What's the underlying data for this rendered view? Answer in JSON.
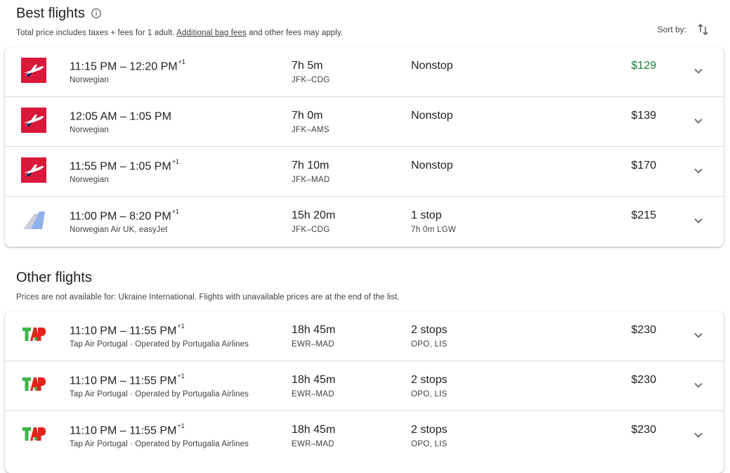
{
  "best": {
    "title": "Best flights",
    "subtitle_prefix": "Total price includes taxes + fees for 1 adult. ",
    "subtitle_link": "Additional bag fees",
    "subtitle_suffix": " and other fees may apply.",
    "sort_label": "Sort by:",
    "flights": [
      {
        "time": "11:15 PM – 12:20 PM",
        "plus": "+1",
        "airline": "Norwegian",
        "duration": "7h 5m",
        "route": "JFK–CDG",
        "stops": "Nonstop",
        "stop_detail": "",
        "price": "$129",
        "logo": "norwegian-logo",
        "price_low": true
      },
      {
        "time": "12:05 AM – 1:05 PM",
        "plus": "",
        "airline": "Norwegian",
        "duration": "7h 0m",
        "route": "JFK–AMS",
        "stops": "Nonstop",
        "stop_detail": "",
        "price": "$139",
        "logo": "norwegian-logo",
        "price_low": false
      },
      {
        "time": "11:55 PM – 1:05 PM",
        "plus": "+1",
        "airline": "Norwegian",
        "duration": "7h 10m",
        "route": "JFK–MAD",
        "stops": "Nonstop",
        "stop_detail": "",
        "price": "$170",
        "logo": "norwegian-logo",
        "price_low": false
      },
      {
        "time": "11:00 PM – 8:20 PM",
        "plus": "+1",
        "airline": "Norwegian Air UK, easyJet",
        "duration": "15h 20m",
        "route": "JFK–CDG",
        "stops": "1 stop",
        "stop_detail": "7h 0m LGW",
        "price": "$215",
        "logo": "multi-airline-tail-logo",
        "price_low": false
      }
    ]
  },
  "other": {
    "title": "Other flights",
    "subtitle": "Prices are not available for: Ukraine International. Flights with unavailable prices are at the end of the list.",
    "flights": [
      {
        "time": "11:10 PM – 11:55 PM",
        "plus": "+1",
        "airline": "Tap Air Portugal · Operated by Portugalia Airlines",
        "duration": "18h 45m",
        "route": "EWR–MAD",
        "stops": "2 stops",
        "stop_detail": "OPO, LIS",
        "price": "$230",
        "logo": "tap-logo",
        "price_low": false
      },
      {
        "time": "11:10 PM – 11:55 PM",
        "plus": "+1",
        "airline": "Tap Air Portugal · Operated by Portugalia Airlines",
        "duration": "18h 45m",
        "route": "EWR–MAD",
        "stops": "2 stops",
        "stop_detail": "OPO, LIS",
        "price": "$230",
        "logo": "tap-logo",
        "price_low": false
      },
      {
        "time": "11:10 PM – 11:55 PM",
        "plus": "+1",
        "airline": "Tap Air Portugal · Operated by Portugalia Airlines",
        "duration": "18h 45m",
        "route": "EWR–MAD",
        "stops": "2 stops",
        "stop_detail": "OPO, LIS",
        "price": "$230",
        "logo": "tap-logo",
        "price_low": false
      }
    ]
  },
  "colors": {
    "low_price": "#188038",
    "norwegian_red": "#d81939",
    "tap_green": "#3db54a",
    "tap_red": "#e2231a"
  }
}
